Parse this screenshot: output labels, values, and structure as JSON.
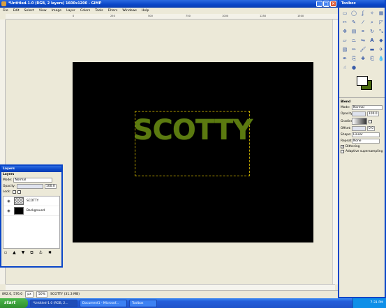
{
  "main_window": {
    "title": "*Untitled-1.0 (RGB, 2 layers) 1600x1200 - GIMP",
    "menus": [
      "File",
      "Edit",
      "Select",
      "View",
      "Image",
      "Layer",
      "Colors",
      "Tools",
      "Filters",
      "Windows",
      "Help"
    ],
    "ruler_ticks": [
      "0",
      "250",
      "500",
      "750",
      "1000",
      "1250",
      "1500"
    ],
    "canvas_text": "SCOTTY",
    "status": {
      "coords": "892.0, 576.0",
      "unit": "px",
      "zoom": "50%",
      "message": "SCOTTY (31.3 MB)"
    }
  },
  "layers_dialog": {
    "title": "Layers",
    "header": "Layers",
    "mode_label": "Mode:",
    "mode_value": "Normal",
    "opacity_label": "Opacity:",
    "opacity_value": "100.0",
    "lock_label": "Lock:",
    "layers": [
      {
        "name": "SCOTTY",
        "thumb": "checker"
      },
      {
        "name": "Background",
        "thumb": "black"
      }
    ]
  },
  "toolbox": {
    "title": "Toolbox",
    "options_title": "Blend",
    "mode_label": "Mode:",
    "mode_value": "Normal",
    "opacity_label": "Opacity:",
    "opacity_value": "100.0",
    "gradient_label": "Gradient:",
    "offset_label": "Offset:",
    "offset_value": "0.0",
    "shape_label": "Shape:",
    "shape_value": "Linear",
    "repeat_label": "Repeat:",
    "repeat_value": "None",
    "dithering_label": "Dithering",
    "adaptive_label": "Adaptive supersampling",
    "foreground_color": "#ffffff",
    "background_color": "#4a6a10"
  },
  "taskbar": {
    "start_label": "start",
    "tasks": [
      "*Untitled-1.0 (RGB, 2...",
      "Document1 - Microsof...",
      "Toolbox"
    ],
    "clock": "7:31 PM"
  }
}
